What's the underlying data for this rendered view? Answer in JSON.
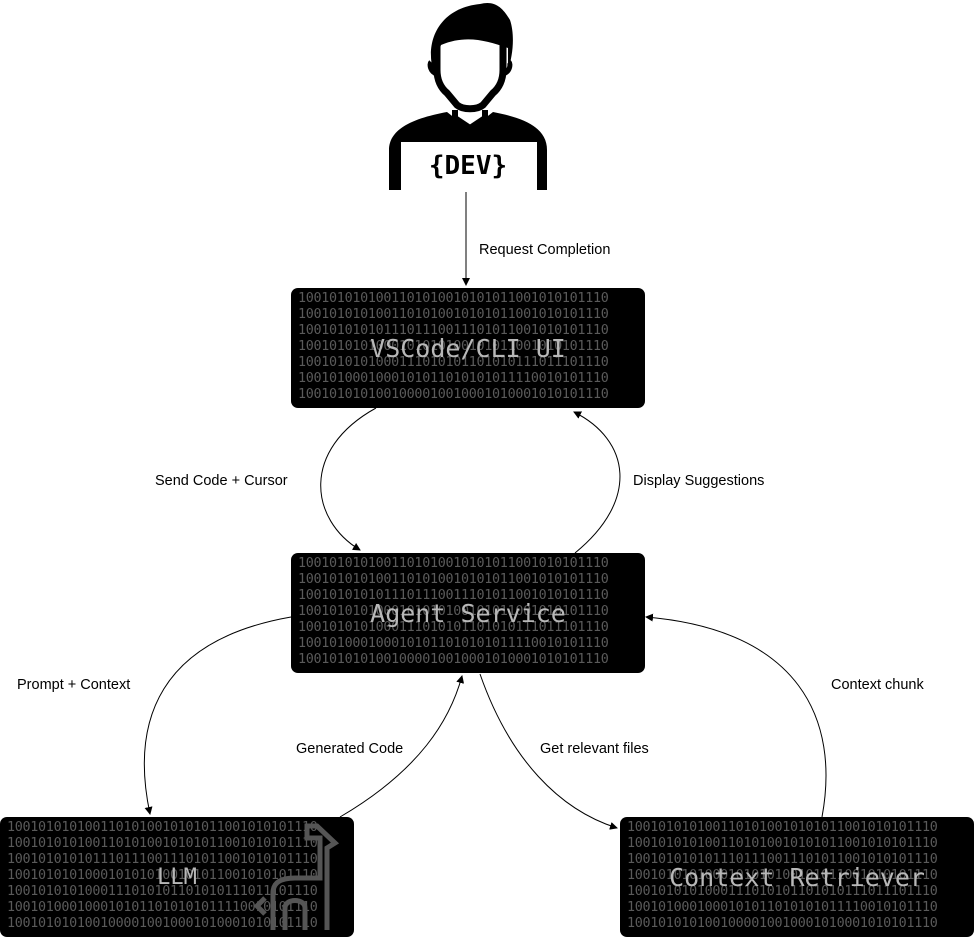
{
  "actor": {
    "label": "{DEV}"
  },
  "binary_rows": [
    "1001010101001101010010101011001010101110",
    "1001010101001101010010101011001010101110",
    "1001010101011101110011101011001010101110",
    "1001010101000101010100101011001010101110",
    "1001010101000111010101101010111011101110",
    "1001010001000101011010101011110010101110",
    "1001010101001000010010001010001010101110"
  ],
  "nodes": {
    "vscode": {
      "label": "VSCode/CLI UI"
    },
    "agent": {
      "label": "Agent Service"
    },
    "llm": {
      "label": "LLM"
    },
    "retriever": {
      "label": "Context Retriever"
    }
  },
  "edges": {
    "request": "Request Completion",
    "send_code": "Send Code + Cursor",
    "display": "Display Suggestions",
    "prompt": "Prompt + Context",
    "generated": "Generated Code",
    "get_files": "Get relevant files",
    "context_chunk": "Context chunk"
  }
}
